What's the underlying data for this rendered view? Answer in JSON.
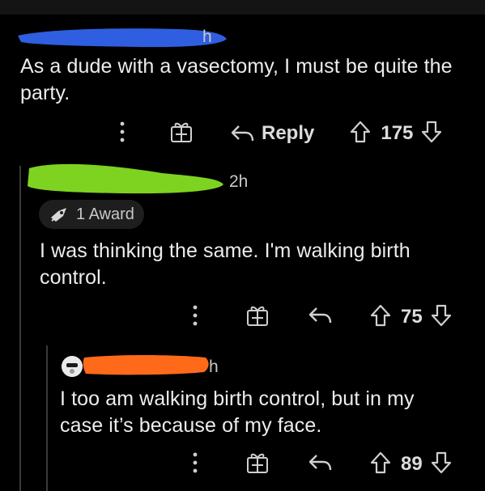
{
  "comments": [
    {
      "meta_time_fragment": "h",
      "body": [
        "As a dude with a vasectomy, I must be quite the",
        "party."
      ],
      "actions": {
        "reply_label": "Reply",
        "score": "175"
      },
      "redaction_color": "#2f5fe0"
    },
    {
      "meta_time": "2h",
      "award": {
        "label": "1 Award",
        "icon": "rocket-like-award-icon"
      },
      "body": [
        "I was thinking the same. I'm walking birth",
        "control."
      ],
      "actions": {
        "score": "75"
      },
      "redaction_color": "#7ed321"
    },
    {
      "meta_time_fragment": "h",
      "body": [
        "I too am walking birth control, but in my",
        "case it’s because of my face."
      ],
      "actions": {
        "score": "89"
      },
      "redaction_color": "#ff6a1a"
    }
  ],
  "colors": {
    "background": "#000000",
    "text": "#ececec",
    "muted": "#c8c8c8",
    "thread_line": "#3a3a3a"
  },
  "icons": [
    "more-icon",
    "gift-icon",
    "reply-arrow-icon",
    "upvote-icon",
    "downvote-icon"
  ]
}
